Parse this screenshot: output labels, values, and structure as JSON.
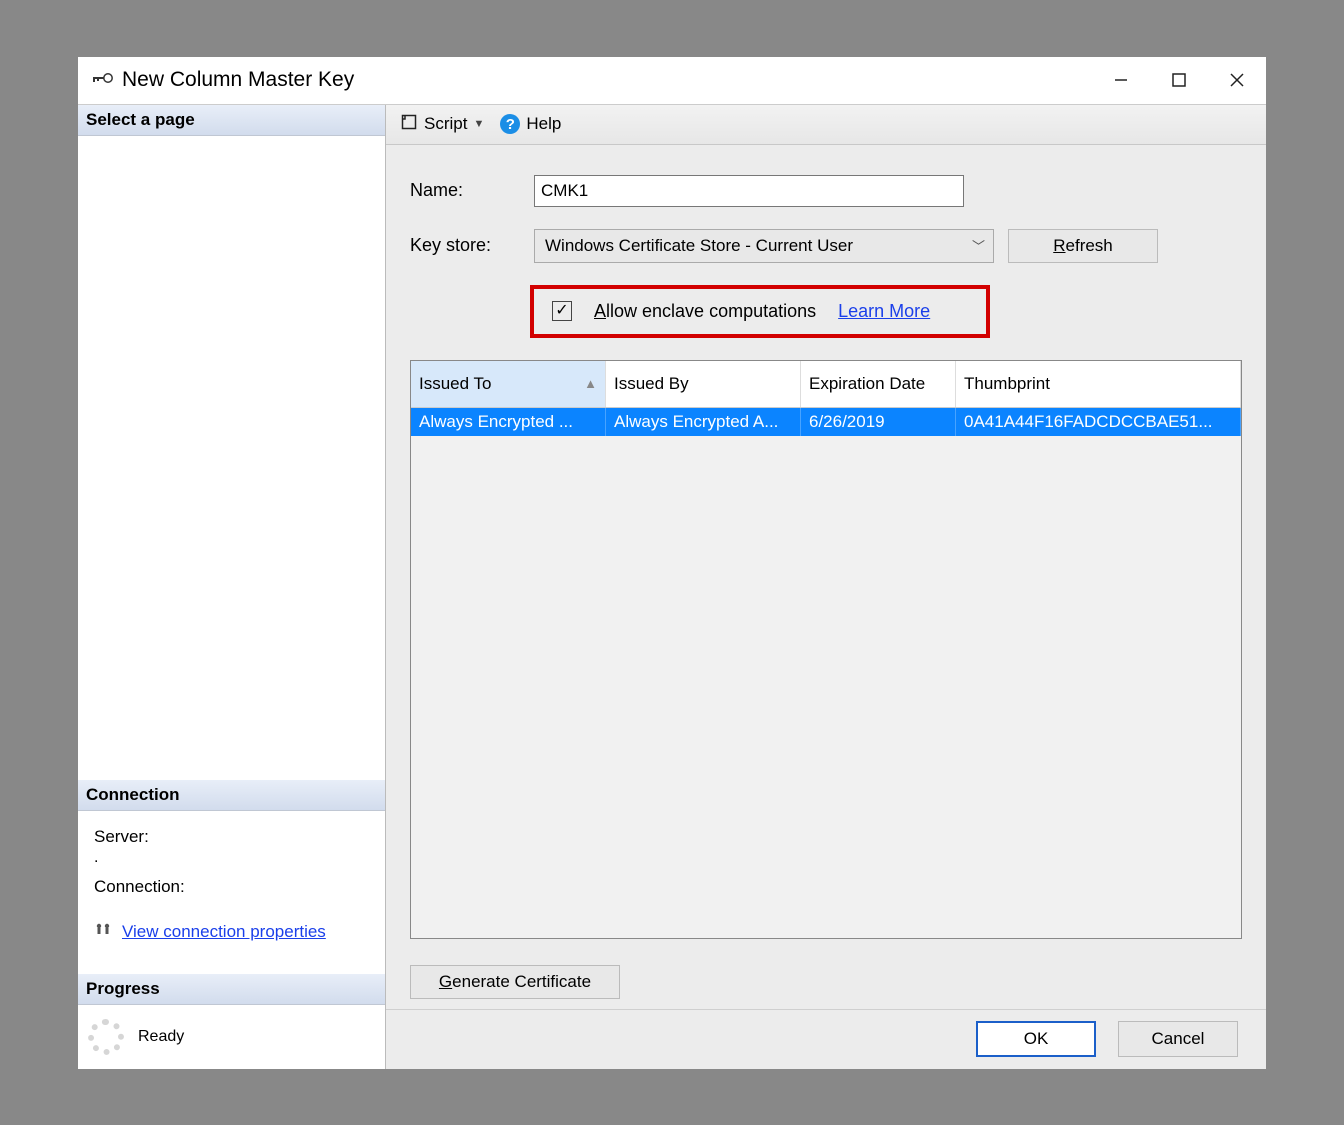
{
  "window": {
    "title": "New Column Master Key"
  },
  "sidebar": {
    "select_page_header": "Select a page",
    "connection_header": "Connection",
    "server_label": "Server:",
    "server_value": ".",
    "connection_label": "Connection:",
    "connection_value": "",
    "view_properties_link": "View connection properties",
    "progress_header": "Progress",
    "progress_status": "Ready"
  },
  "toolbar": {
    "script_label": "Script",
    "help_label": "Help"
  },
  "form": {
    "name_label": "Name:",
    "name_value": "CMK1",
    "keystore_label": "Key store:",
    "keystore_value": "Windows Certificate Store - Current User",
    "refresh_label": "Refresh",
    "refresh_mnemonic": "R",
    "allow_enclave_label": "Allow enclave computations",
    "allow_enclave_mnemonic": "A",
    "allow_enclave_checked": true,
    "learn_more_label": "Learn More",
    "generate_cert_label": "Generate Certificate",
    "generate_cert_mnemonic": "G"
  },
  "grid": {
    "columns": {
      "issued_to": "Issued To",
      "issued_by": "Issued By",
      "expiration": "Expiration Date",
      "thumbprint": "Thumbprint"
    },
    "rows": [
      {
        "issued_to": "Always Encrypted ...",
        "issued_by": "Always Encrypted A...",
        "expiration": "6/26/2019",
        "thumbprint": "0A41A44F16FADCDCCBAE51..."
      }
    ]
  },
  "footer": {
    "ok_label": "OK",
    "cancel_label": "Cancel"
  }
}
